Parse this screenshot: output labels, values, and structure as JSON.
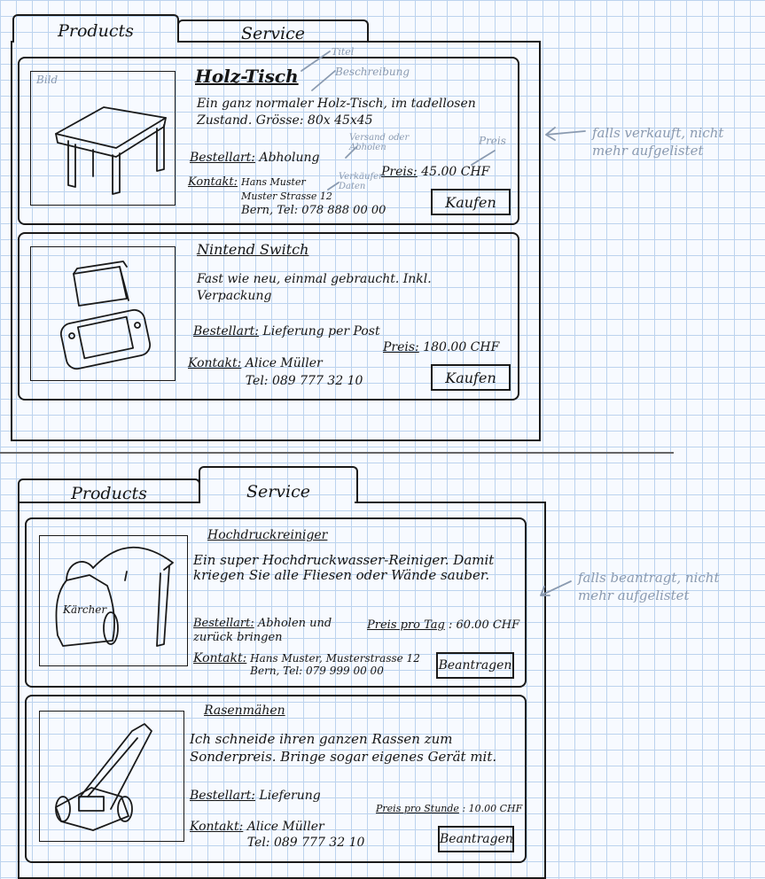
{
  "top_panel": {
    "tabs": [
      {
        "label": "Products",
        "active": true
      },
      {
        "label": "Service",
        "active": false
      }
    ],
    "note": "falls verkauft, nicht mehr aufgelistet",
    "items": [
      {
        "image_label": "Bild",
        "title": "Holz-Tisch",
        "description": "Ein ganz normaler Holz-Tisch, im tadellosen Zustand. Grösse: 80x 45x45",
        "order_label": "Bestellart:",
        "order_value": "Abholung",
        "contact_label": "Kontakt:",
        "contact_lines": [
          "Hans Muster",
          "Muster Strasse 12",
          "Bern, Tel: 078 888 00 00"
        ],
        "price_label": "Preis:",
        "price": "45.00 CHF",
        "button": "Kaufen",
        "annotations": {
          "title": "Titel",
          "description": "Beschreibung",
          "order": "Versand oder Abholen",
          "contact": "Verkäufer Daten",
          "price": "Preis"
        }
      },
      {
        "title": "Nintend Switch",
        "description": "Fast wie neu, einmal gebraucht. Inkl. Verpackung",
        "order_label": "Bestellart:",
        "order_value": "Lieferung per Post",
        "contact_label": "Kontakt:",
        "contact_lines": [
          "Alice Müller",
          "Tel: 089 777 32 10"
        ],
        "price_label": "Preis:",
        "price": "180.00 CHF",
        "button": "Kaufen"
      }
    ]
  },
  "bottom_panel": {
    "tabs": [
      {
        "label": "Products",
        "active": false
      },
      {
        "label": "Service",
        "active": true
      }
    ],
    "note": "falls beantragt, nicht mehr aufgelistet",
    "items": [
      {
        "title": "Hochdruckreiniger",
        "description": "Ein super Hochdruckwasser-Reiniger. Damit kriegen Sie alle Fliesen oder Wände sauber.",
        "order_label": "Bestellart:",
        "order_value": "Abholen und zurück bringen",
        "contact_label": "Kontakt:",
        "contact_lines": [
          "Hans Muster, Musterstrasse 12",
          "Bern, Tel: 079 999 00 00"
        ],
        "price_label": "Preis pro Tag",
        "price": ": 60.00 CHF",
        "image_text": "Kärcher",
        "button": "Beantragen"
      },
      {
        "title": "Rasenmähen",
        "description": "Ich schneide ihren ganzen Rassen zum Sonderpreis. Bringe sogar eigenes Gerät mit.",
        "order_label": "Bestellart:",
        "order_value": "Lieferung",
        "contact_label": "Kontakt:",
        "contact_lines": [
          "Alice Müller",
          "Tel: 089 777 32 10"
        ],
        "price_label": "Preis pro Stunde",
        "price": ": 10.00 CHF",
        "button": "Beantragen"
      }
    ]
  }
}
